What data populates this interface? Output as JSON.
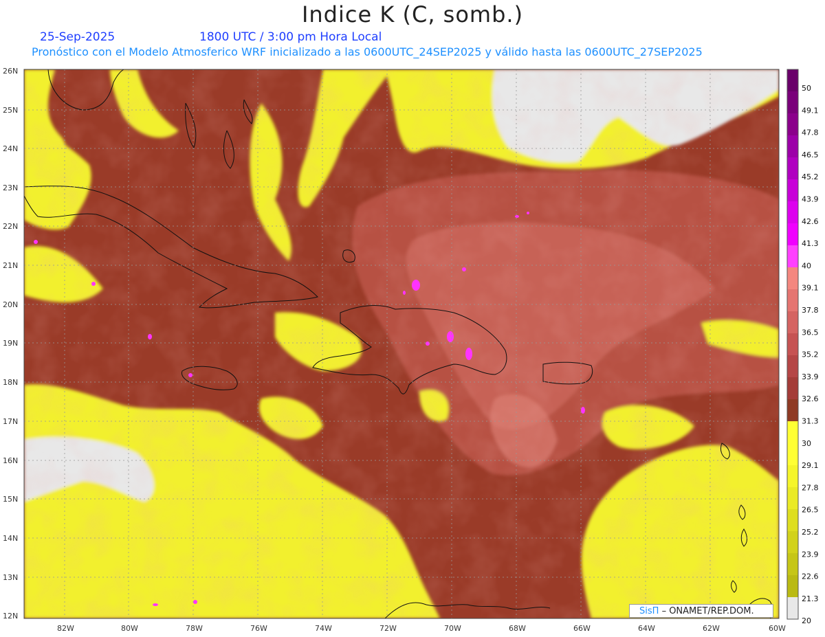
{
  "title": "Indice K (C, somb.)",
  "date": "25-Sep-2025",
  "time": "1800 UTC / 3:00 pm Hora Local",
  "forecast_text": "Pronóstico con el Modelo Atmosferico WRF inicializado a las 0600UTC_24SEP2025 y válido hasta las  0600UTC_27SEP2025",
  "credit": {
    "brand": "SisΠ",
    "org": "– ONAMET/REP.DOM."
  },
  "map": {
    "lat_labels": [
      "26N",
      "25N",
      "24N",
      "23N",
      "22N",
      "21N",
      "20N",
      "19N",
      "18N",
      "17N",
      "16N",
      "15N",
      "14N",
      "13N",
      "12N"
    ],
    "lon_labels": [
      "82W",
      "80W",
      "78W",
      "76W",
      "74W",
      "72W",
      "70W",
      "68W",
      "66W",
      "64W",
      "62W",
      "60W"
    ]
  },
  "colorbar": {
    "levels": [
      "50",
      "49.1",
      "47.8",
      "46.5",
      "45.2",
      "43.9",
      "42.6",
      "41.3",
      "40",
      "39.1",
      "37.8",
      "36.5",
      "35.2",
      "33.9",
      "32.6",
      "31.3",
      "30",
      "29.1",
      "27.8",
      "26.5",
      "25.2",
      "23.9",
      "22.6",
      "21.3",
      "20"
    ],
    "colors": [
      "#6a006a",
      "#7a007a",
      "#8b008b",
      "#9c00a8",
      "#b000c0",
      "#c800d8",
      "#dd00ee",
      "#f000ff",
      "#ff40ff",
      "#f4877f",
      "#e57571",
      "#d56462",
      "#c65353",
      "#b54646",
      "#a43c38",
      "#8f3a24",
      "#ff2a00",
      "#ffff33",
      "#f5f52a",
      "#eaea25",
      "#dede20",
      "#d2d21b",
      "#c6c617",
      "#baba13",
      "#e8e8e8"
    ]
  }
}
